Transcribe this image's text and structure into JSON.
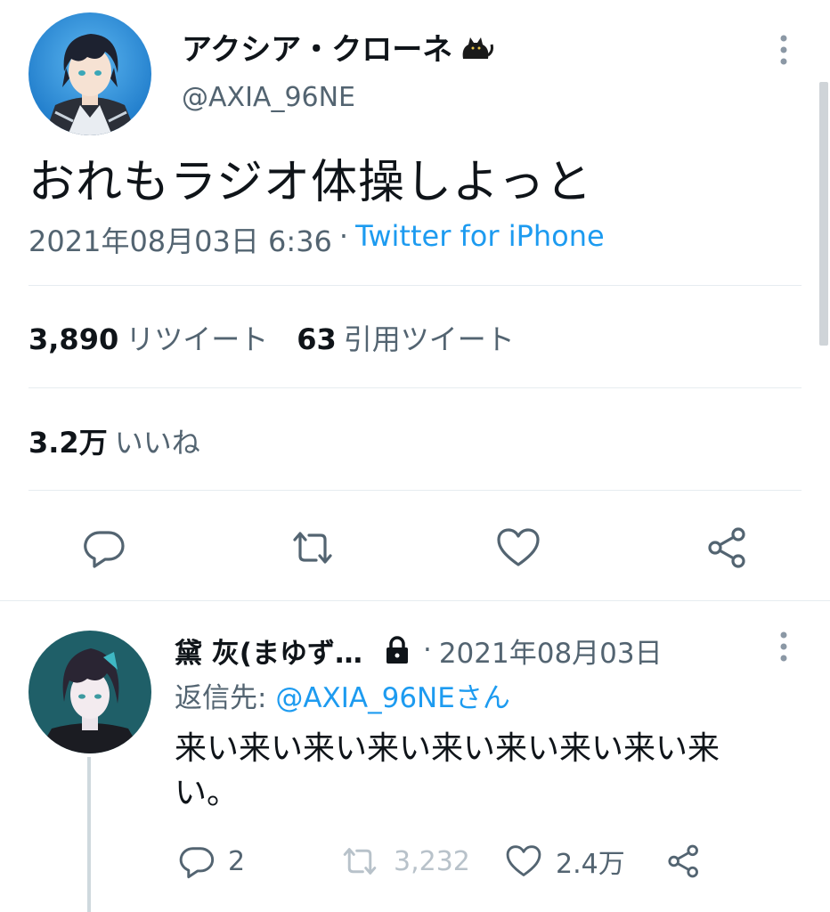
{
  "main_tweet": {
    "display_name": "アクシア・クローネ",
    "name_emoji": "🐈‍⬛",
    "handle": "@AXIA_96NE",
    "text": "おれもラジオ体操しよっと",
    "timestamp": "2021年08月03日 6:36",
    "separator": "·",
    "source": "Twitter for iPhone",
    "stats": {
      "retweets_count": "3,890",
      "retweets_label": "リツイート",
      "quotes_count": "63",
      "quotes_label": "引用ツイート",
      "likes_count": "3.2万",
      "likes_label": "いいね"
    }
  },
  "reply": {
    "display_name": "黛 灰(まゆず…",
    "separator": "·",
    "date": "2021年08月03日",
    "reply_to_prefix": "返信先: ",
    "reply_to_handle": "@AXIA_96NEさん",
    "text": "来い来い来い来い来い来い来い来い来い。",
    "reply_count": "2",
    "retweet_count": "3,232",
    "like_count": "2.4万"
  },
  "colors": {
    "accent": "#1d9bf0",
    "text": "#0f1419",
    "muted": "#536471",
    "divider": "#e6ecf0"
  }
}
